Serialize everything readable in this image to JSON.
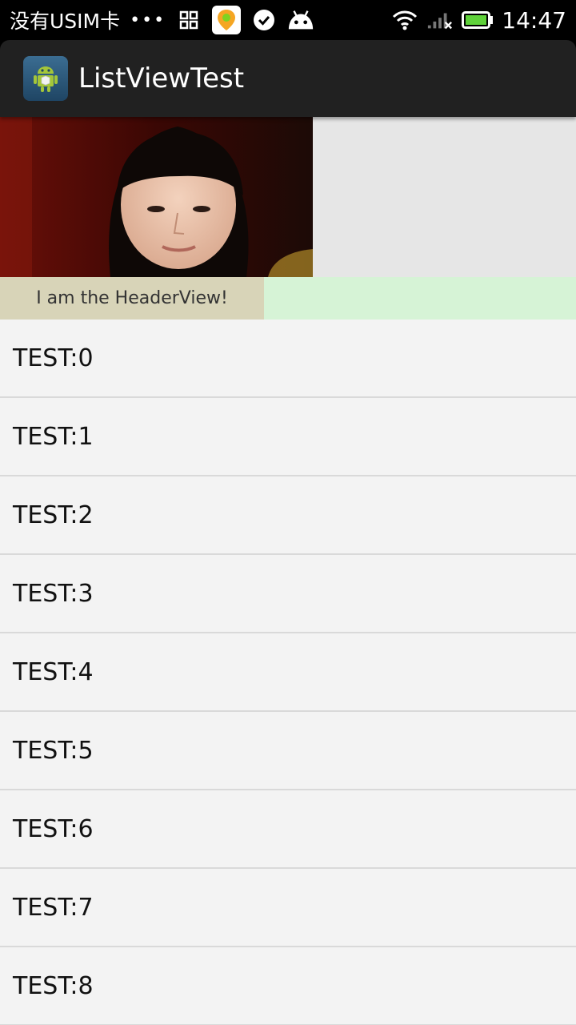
{
  "status_bar": {
    "carrier": "没有USIM卡",
    "more": "•••",
    "icons": [
      "grid-icon",
      "map-pin-icon",
      "check-circle-icon",
      "android-icon",
      "wifi-icon",
      "signal-icon",
      "battery-icon"
    ],
    "time": "14:47"
  },
  "action_bar": {
    "title": "ListViewTest",
    "icon": "android-app-icon",
    "background": "#212121"
  },
  "header": {
    "label": "I am the HeaderView!",
    "label_bg": "#d8d4b8",
    "filler_bg": "#d6f3d6"
  },
  "list": {
    "items": [
      {
        "label": "TEST:0"
      },
      {
        "label": "TEST:1"
      },
      {
        "label": "TEST:2"
      },
      {
        "label": "TEST:3"
      },
      {
        "label": "TEST:4"
      },
      {
        "label": "TEST:5"
      },
      {
        "label": "TEST:6"
      },
      {
        "label": "TEST:7"
      },
      {
        "label": "TEST:8"
      }
    ]
  }
}
